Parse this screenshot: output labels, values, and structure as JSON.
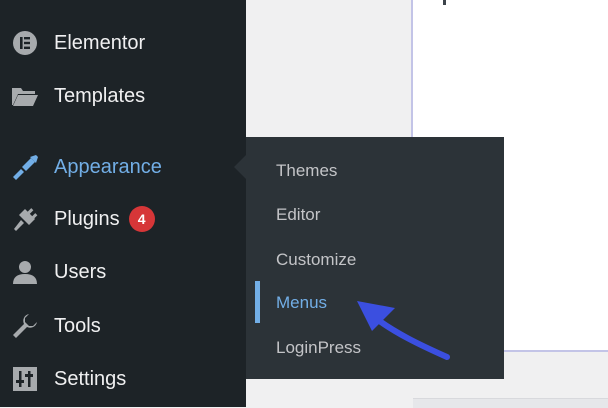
{
  "sidebar": {
    "items": [
      {
        "label": "Elementor",
        "icon": "elementor-icon"
      },
      {
        "label": "Templates",
        "icon": "folder-icon"
      },
      {
        "label": "Appearance",
        "icon": "paintbrush-icon",
        "active": true
      },
      {
        "label": "Plugins",
        "icon": "plug-icon",
        "badge": "4"
      },
      {
        "label": "Users",
        "icon": "user-icon"
      },
      {
        "label": "Tools",
        "icon": "wrench-icon"
      },
      {
        "label": "Settings",
        "icon": "settings-sliders-icon"
      }
    ]
  },
  "submenu": {
    "items": [
      {
        "label": "Themes"
      },
      {
        "label": "Editor"
      },
      {
        "label": "Customize"
      },
      {
        "label": "Menus",
        "current": true
      },
      {
        "label": "LoginPress"
      }
    ]
  },
  "colors": {
    "sidebar_bg": "#1d2327",
    "flyout_bg": "#2c3338",
    "accent": "#72aee6",
    "badge": "#d63638",
    "arrow": "#3b4fe0"
  }
}
